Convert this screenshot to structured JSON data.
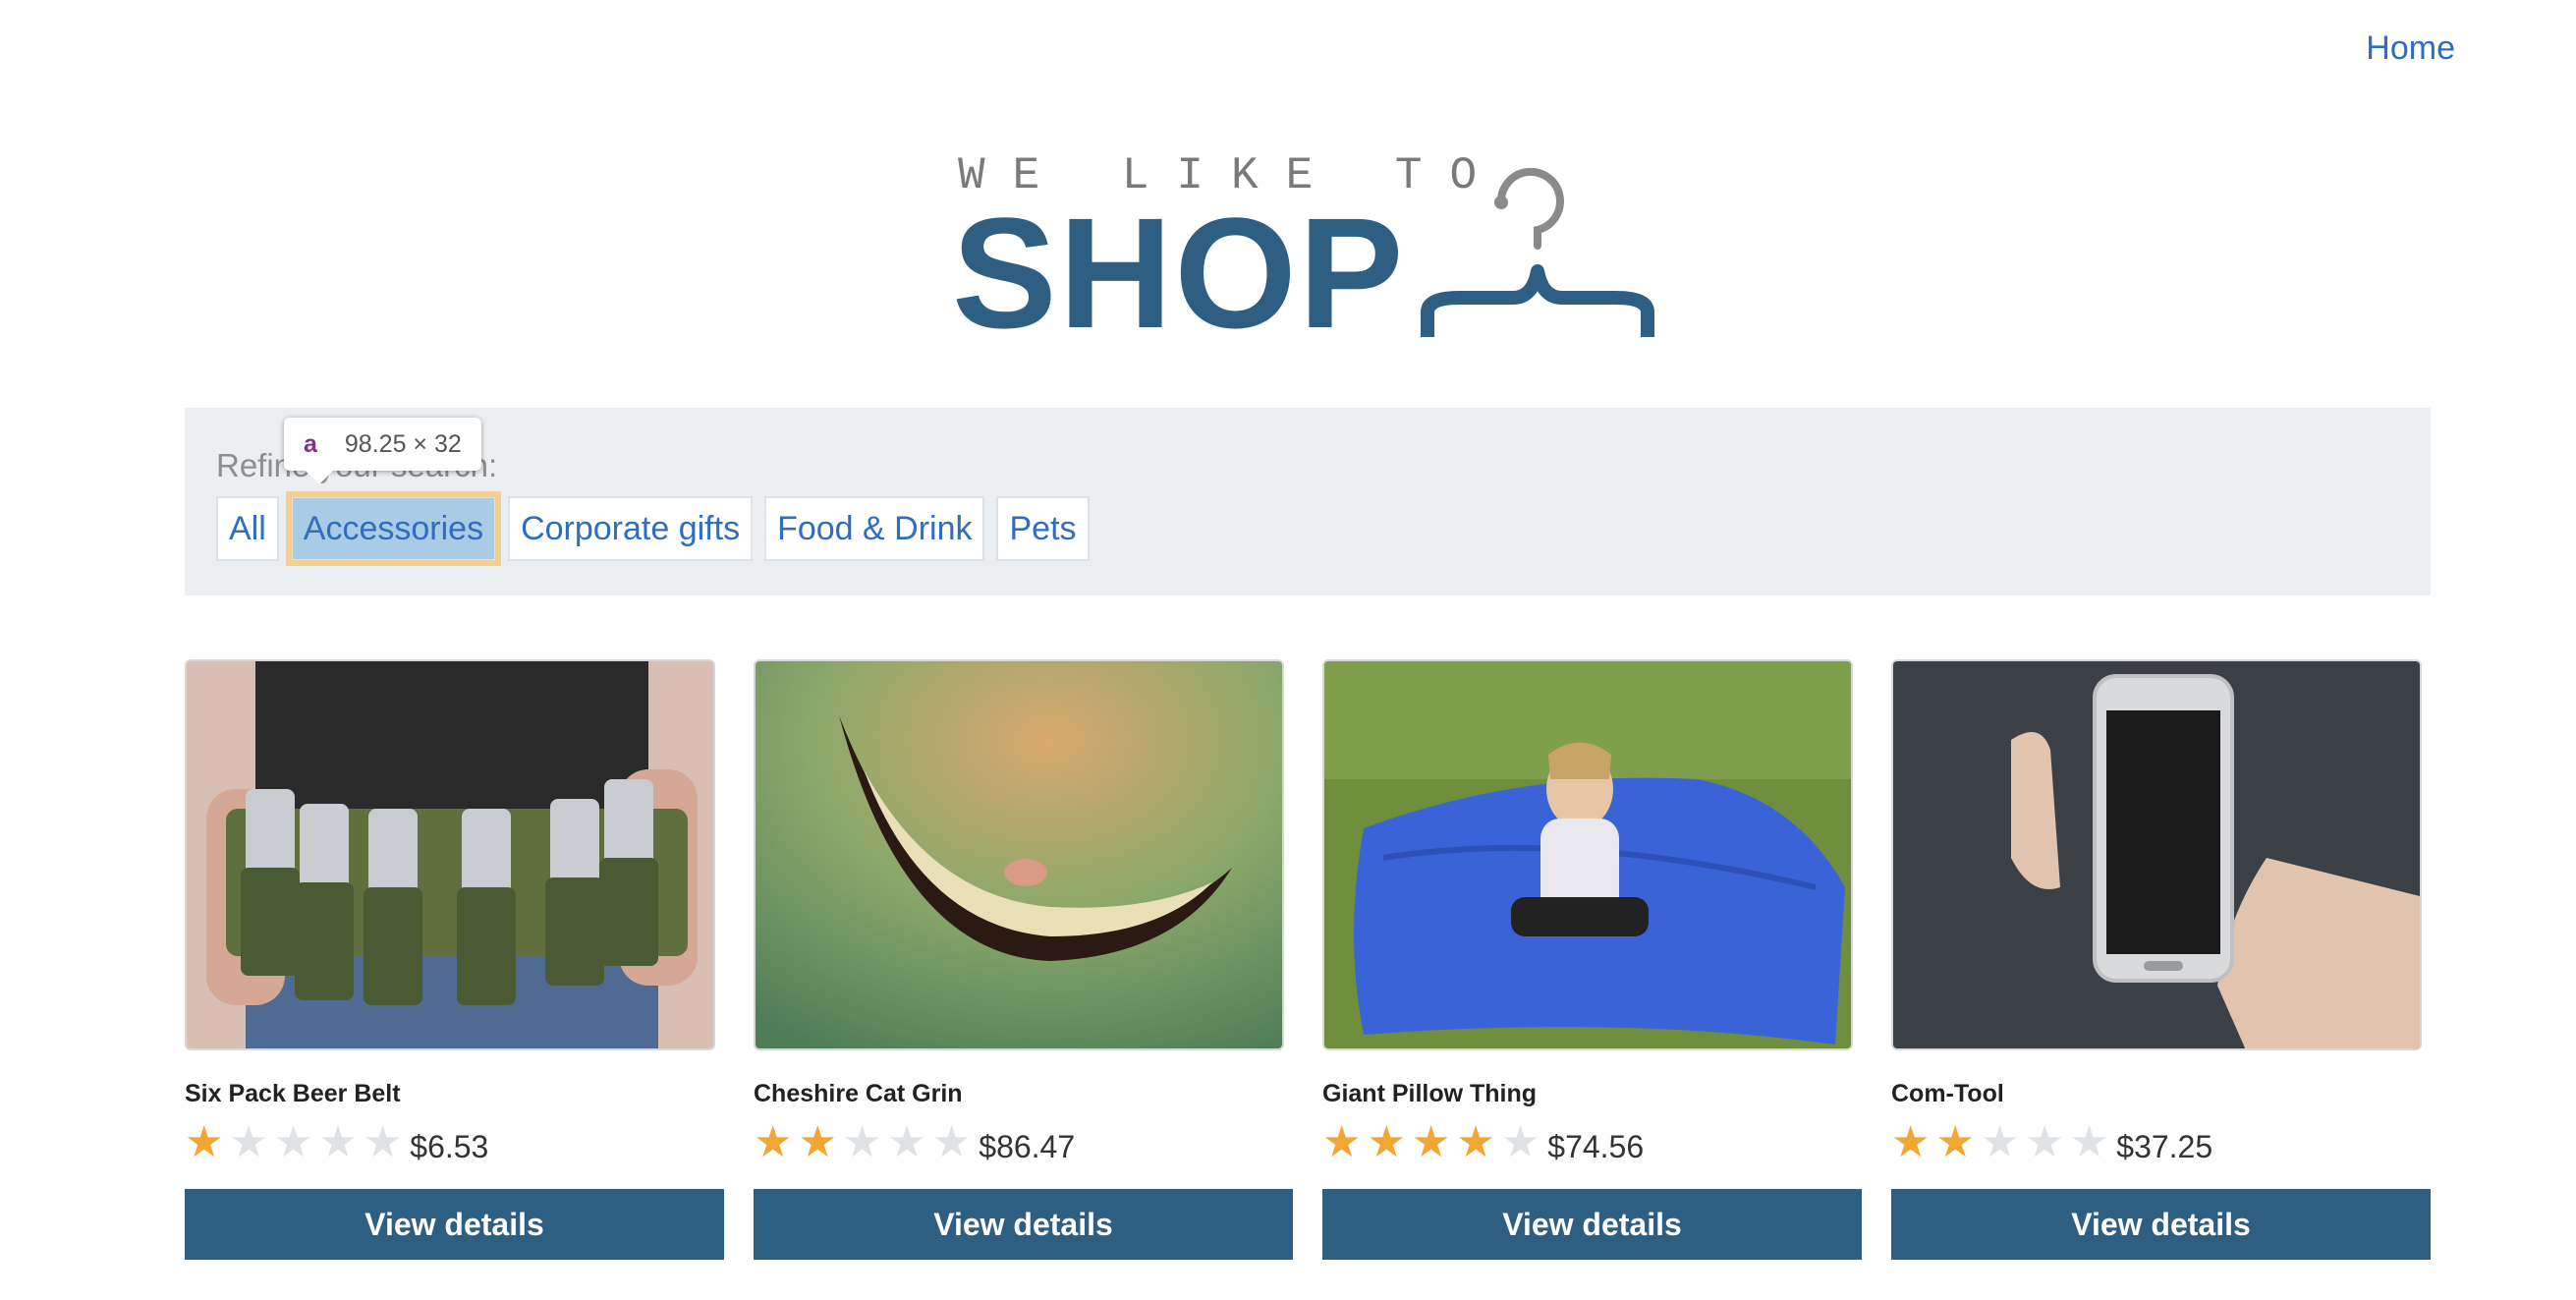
{
  "nav": {
    "home": "Home"
  },
  "logo": {
    "tagline": "WE LIKE TO",
    "word": "SHOP"
  },
  "filter": {
    "label": "Refine your search:",
    "tabs": [
      "All",
      "Accessories",
      "Corporate gifts",
      "Food & Drink",
      "Pets"
    ],
    "active": "Accessories"
  },
  "devtools_tooltip": {
    "tag": "a",
    "size": "98.25 × 32"
  },
  "products": [
    {
      "name": "Six Pack Beer Belt",
      "rating": 1,
      "price": "$6.53",
      "button": "View details"
    },
    {
      "name": "Cheshire Cat Grin",
      "rating": 2,
      "price": "$86.47",
      "button": "View details"
    },
    {
      "name": "Giant Pillow Thing",
      "rating": 4,
      "price": "$74.56",
      "button": "View details"
    },
    {
      "name": "Com-Tool",
      "rating": 2,
      "price": "$37.25",
      "button": "View details"
    }
  ],
  "rating_max": 5,
  "colors": {
    "brand": "#2e5f82",
    "link": "#2e6dbf",
    "star_on": "#f2a634",
    "star_off": "#dfe3e6",
    "panel": "#eceff2"
  }
}
